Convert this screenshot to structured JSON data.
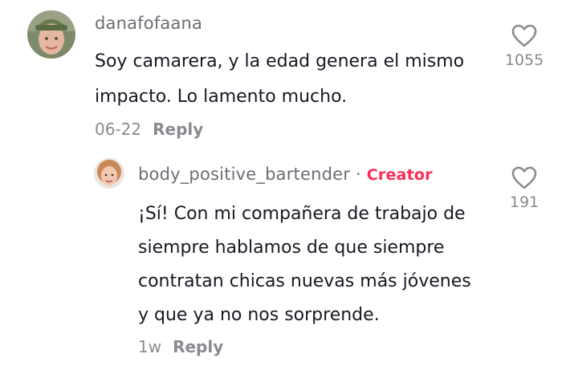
{
  "comments": [
    {
      "username": "danafofaana",
      "text_lines": [
        "Soy camarera, y la edad genera el mismo",
        "impacto. Lo lamento mucho."
      ],
      "date": "06-22",
      "reply_label": "Reply",
      "like_count": "1055",
      "icons": {
        "like": "heart-outline-icon"
      }
    },
    {
      "username": "body_positive_bartender",
      "separator": "·",
      "badge": "Creator",
      "text_lines": [
        "¡Sí! Con mi compañera de trabajo de",
        "siempre hablamos de que siempre",
        "contratan chicas nuevas más jóvenes",
        "y que ya no nos sorprende."
      ],
      "date": "1w",
      "reply_label": "Reply",
      "like_count": "191",
      "icons": {
        "like": "heart-outline-icon"
      }
    }
  ],
  "colors": {
    "text": "#161823",
    "muted": "#8a8b91",
    "creator": "#fe2c55"
  }
}
